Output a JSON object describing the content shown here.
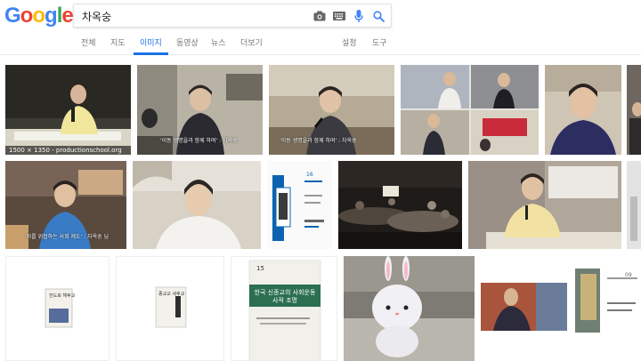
{
  "logo": {
    "letters": [
      "G",
      "o",
      "o",
      "g",
      "l",
      "e"
    ],
    "colors": [
      "#4285f4",
      "#ea4335",
      "#fbbc05",
      "#4285f4",
      "#34a853",
      "#ea4335"
    ]
  },
  "search": {
    "query": "차옥숭"
  },
  "icons": {
    "camera": "camera-icon",
    "keyboard": "keyboard-icon",
    "mic": "microphone-icon",
    "search": "search-icon"
  },
  "tabs": [
    {
      "label": "전체"
    },
    {
      "label": "지도"
    },
    {
      "label": "이미지"
    },
    {
      "label": "동영상"
    },
    {
      "label": "뉴스"
    },
    {
      "label": "더보기"
    }
  ],
  "tools": {
    "settings": "설정",
    "tools": "도구"
  },
  "accent": "#1a73e8",
  "results": {
    "first_caption": "1500 × 1350 - productionschool.org",
    "captions": [
      "'이동 생명을과 함께 하며' : 차옥숭",
      "'이동 생명을과 함께 하며' : 차옥숭",
      "'저를 위협하는 사회 제도' : 차옥숭 님"
    ],
    "book1_title": "한도로 해후교",
    "book2_title": "종교교 세후교",
    "book3_top": "15",
    "book3_title": "한국 신종교의 사회운동사적 조명",
    "book4_top": "09",
    "book4_title": "이동 고통의 이행의 신비함",
    "small_book_title": "세후정과 시판의 종교",
    "small_book_num": "16"
  }
}
